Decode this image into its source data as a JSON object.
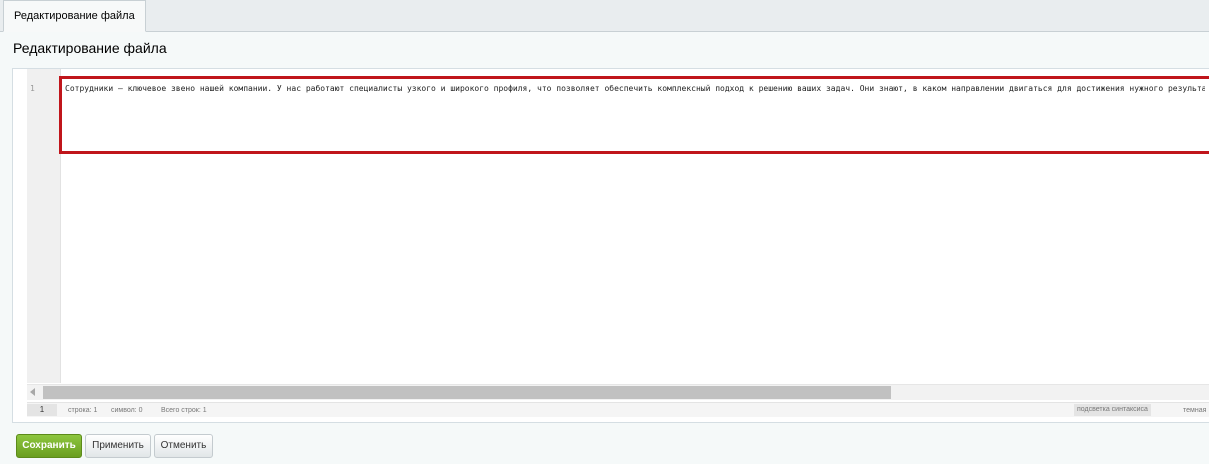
{
  "tab": {
    "label": "Редактирование файла"
  },
  "page": {
    "title": "Редактирование файла"
  },
  "editor": {
    "line_number": "1",
    "content": "Сотрудники — ключевое звено нашей компании. У нас работают специалисты узкого и широкого профиля, что позволяет обеспечить комплексный подход к решению ваших задач. Они знают, в каком направлении двигаться для достижения нужного результата.",
    "highlight_color": "#c0151b"
  },
  "statusbar": {
    "line_badge": "1",
    "row": "строка: 1",
    "symbol": "символ: 0",
    "total": "Всего строк: 1",
    "syntax": "подсветка синтаксиса",
    "theme": "темная"
  },
  "buttons": {
    "save": "Сохранить",
    "apply": "Применить",
    "cancel": "Отменить"
  },
  "colors": {
    "accent_green": "#6a9e1f",
    "panel_bg": "#f5f9f9"
  }
}
